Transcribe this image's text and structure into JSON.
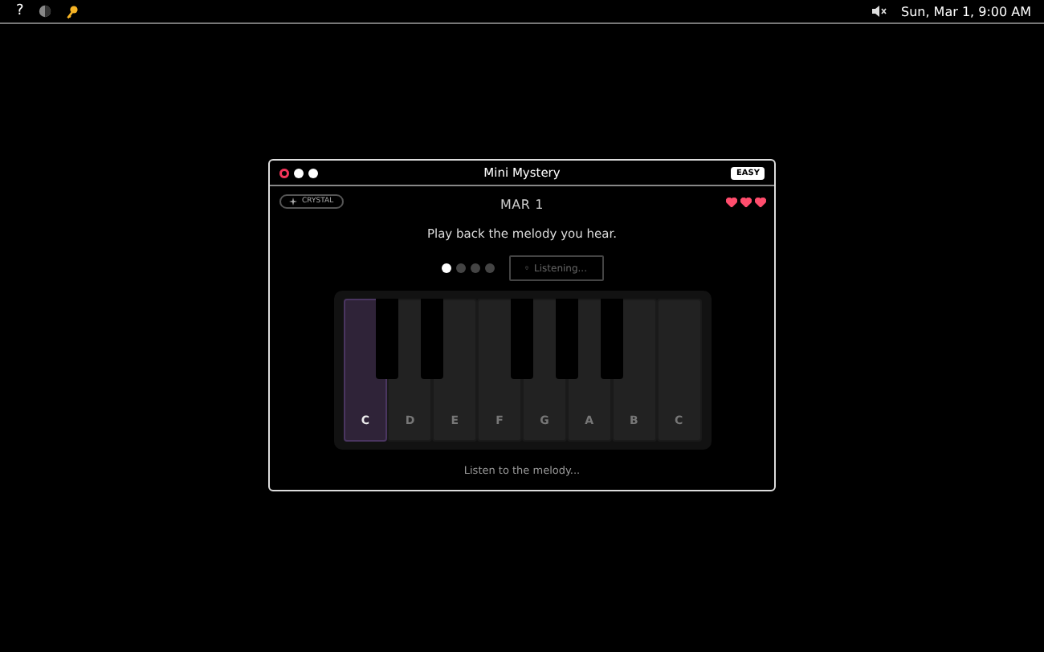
{
  "menu_bar": {
    "help": "?",
    "clock": "Sun, Mar 1, 9:00 AM"
  },
  "window": {
    "title": "Mini Mystery",
    "difficulty": "EASY"
  },
  "badge": {
    "label": "CRYSTAL"
  },
  "hearts": [
    {
      "filled": true
    },
    {
      "filled": true
    },
    {
      "filled": true
    }
  ],
  "date": "MAR 1",
  "instruction": "Play back the melody you hear.",
  "steps": [
    {
      "selected": true
    },
    {
      "selected": false
    },
    {
      "selected": false
    },
    {
      "selected": false
    }
  ],
  "listen_button": {
    "label": "Listening...",
    "disabled": true
  },
  "white_keys": [
    {
      "label": "C",
      "selected": true,
      "sharp": true
    },
    {
      "label": "D",
      "selected": false,
      "sharp": true
    },
    {
      "label": "E",
      "selected": false,
      "sharp": false
    },
    {
      "label": "F",
      "selected": false,
      "sharp": true
    },
    {
      "label": "G",
      "selected": false,
      "sharp": true
    },
    {
      "label": "A",
      "selected": false,
      "sharp": true
    },
    {
      "label": "B",
      "selected": false,
      "sharp": false
    },
    {
      "label": "C",
      "selected": false,
      "sharp": false
    }
  ],
  "status": "Listen to the melody..."
}
